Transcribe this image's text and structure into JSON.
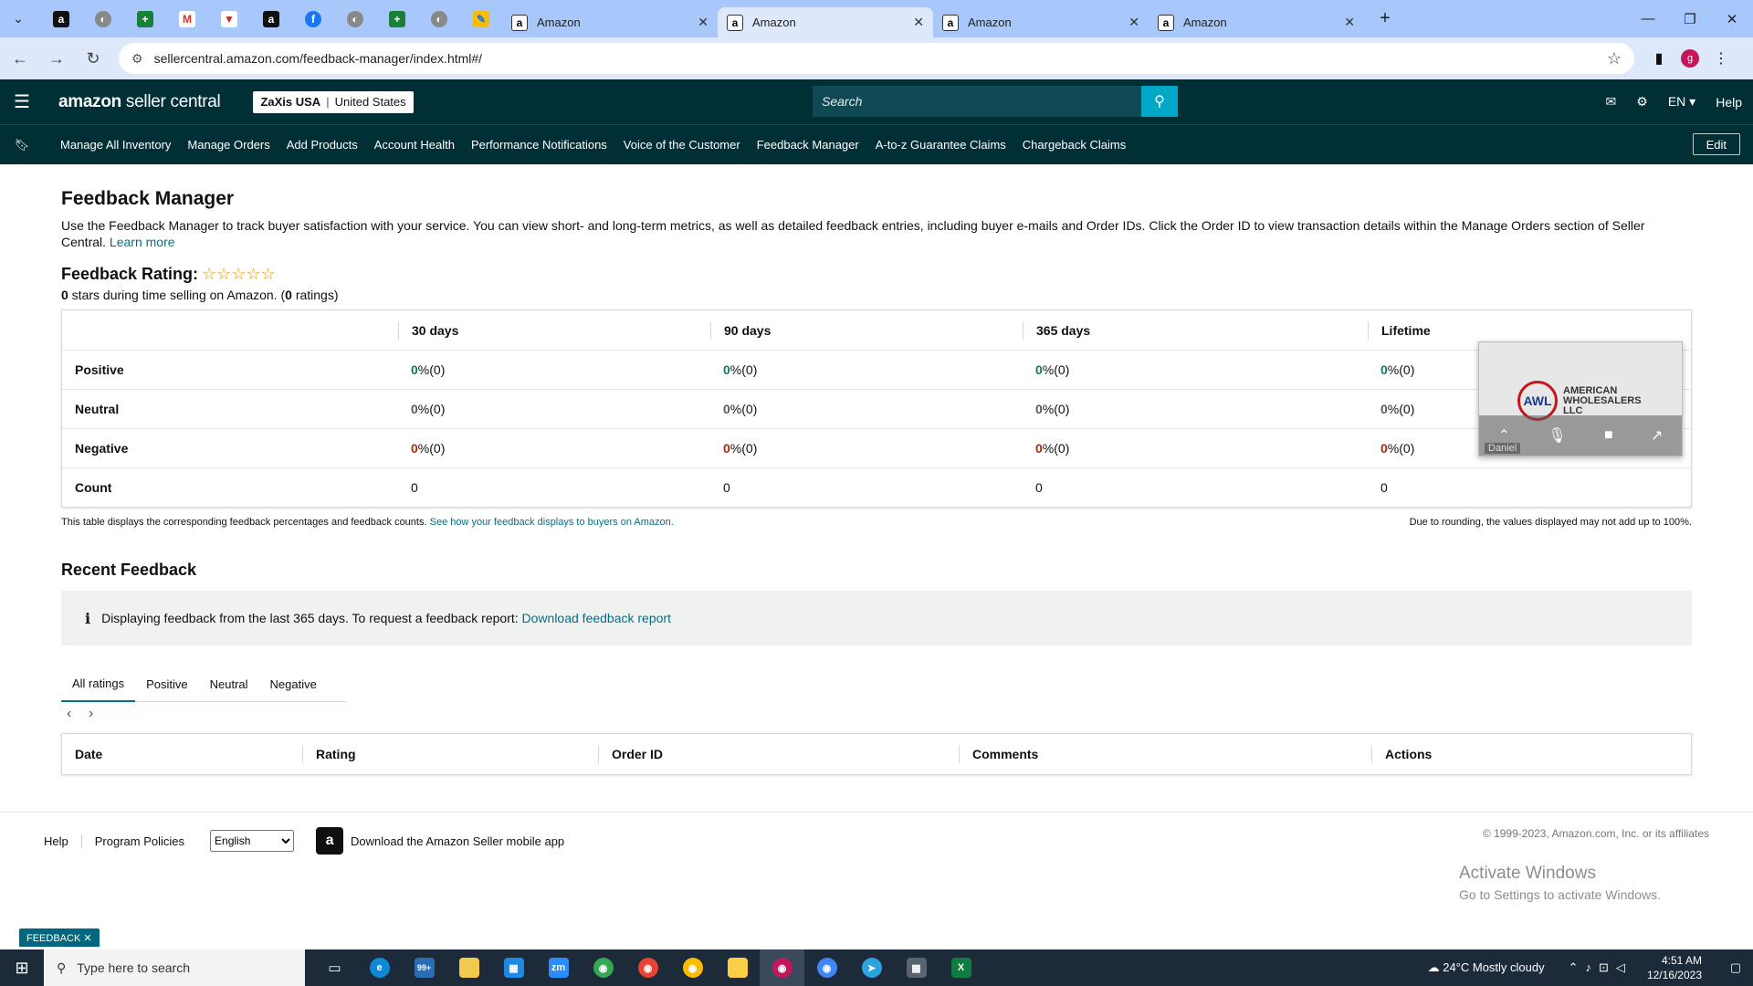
{
  "browser": {
    "tabs": [
      {
        "title": "Amazon",
        "active": false
      },
      {
        "title": "Amazon",
        "active": true
      },
      {
        "title": "Amazon",
        "active": false
      },
      {
        "title": "Amazon",
        "active": false
      }
    ],
    "url": "sellercentral.amazon.com/feedback-manager/index.html#/",
    "profile_initial": "g"
  },
  "header": {
    "logo_bold": "amazon",
    "logo_rest": " seller central",
    "account_name": "ZaXis USA",
    "account_sep": "|",
    "account_region": "United States",
    "search_placeholder": "Search",
    "language": "EN",
    "help": "Help"
  },
  "nav": {
    "items": [
      "Manage All Inventory",
      "Manage Orders",
      "Add Products",
      "Account Health",
      "Performance Notifications",
      "Voice of the Customer",
      "Feedback Manager",
      "A-to-z Guarantee Claims",
      "Chargeback Claims"
    ],
    "edit_label": "Edit"
  },
  "page": {
    "title": "Feedback Manager",
    "description": "Use the Feedback Manager to track buyer satisfaction with your service. You can view short- and long-term metrics, as well as detailed feedback entries, including buyer e-mails and Order IDs. Click the Order ID to view transaction details within the Manage Orders section of Seller Central.",
    "learn_more": "Learn more",
    "rating_title": "Feedback Rating:",
    "rating_stars": 0,
    "rating_stars_glyphs": "☆☆☆☆☆",
    "rating_sub_stars": "0",
    "rating_sub_text1": " stars during time selling on Amazon. (",
    "rating_sub_count": "0",
    "rating_sub_text2": " ratings)"
  },
  "metrics": {
    "columns": [
      "30 days",
      "90 days",
      "365 days",
      "Lifetime"
    ],
    "rows": [
      {
        "label": "Positive",
        "color": "#067d62",
        "values": [
          {
            "pct": "0",
            "suffix": " %(0)"
          },
          {
            "pct": "0",
            "suffix": " %(0)"
          },
          {
            "pct": "0",
            "suffix": " %(0)"
          },
          {
            "pct": "0",
            "suffix": " %(0)"
          }
        ]
      },
      {
        "label": "Neutral",
        "color": "#565959",
        "values": [
          {
            "pct": "0",
            "suffix": " %(0)"
          },
          {
            "pct": "0",
            "suffix": " %(0)"
          },
          {
            "pct": "0",
            "suffix": " %(0)"
          },
          {
            "pct": "0",
            "suffix": " %(0)"
          }
        ]
      },
      {
        "label": "Negative",
        "color": "#b12704",
        "values": [
          {
            "pct": "0",
            "suffix": " %(0)"
          },
          {
            "pct": "0",
            "suffix": " %(0)"
          },
          {
            "pct": "0",
            "suffix": " %(0)"
          },
          {
            "pct": "0",
            "suffix": " %(0)"
          }
        ]
      }
    ],
    "count_label": "Count",
    "counts": [
      "0",
      "0",
      "0",
      "0"
    ],
    "note_left": "This table displays the corresponding feedback percentages and feedback counts.",
    "note_link": "See how your feedback displays to buyers on Amazon.",
    "note_right": "Due to rounding, the values displayed may not add up to 100%."
  },
  "recent": {
    "title": "Recent Feedback",
    "info_text": "Displaying feedback from the last 365 days. To request a feedback report:",
    "info_link": "Download feedback report",
    "tabs": [
      "All ratings",
      "Positive",
      "Neutral",
      "Negative"
    ],
    "active_tab": "All ratings",
    "table_columns": [
      "Date",
      "Rating",
      "Order ID",
      "Comments",
      "Actions"
    ]
  },
  "footer": {
    "help": "Help",
    "policies": "Program Policies",
    "language_selected": "English",
    "app_text": "Download the Amazon Seller mobile app",
    "copyright": "© 1999-2023, Amazon.com, Inc. or its affiliates",
    "activate_title": "Activate Windows",
    "activate_sub": "Go to Settings to activate Windows.",
    "feedback_tag": "FEEDBACK ✕"
  },
  "video": {
    "company_line1": "AMERICAN",
    "company_line2": "WHOLESALERS",
    "company_line3": "LLC",
    "logo_text": "AWL",
    "participant": "Daniel"
  },
  "taskbar": {
    "search_placeholder": "Type here to search",
    "mail_badge": "99+",
    "weather": "24°C  Mostly cloudy",
    "time": "4:51 AM",
    "date": "12/16/2023"
  }
}
